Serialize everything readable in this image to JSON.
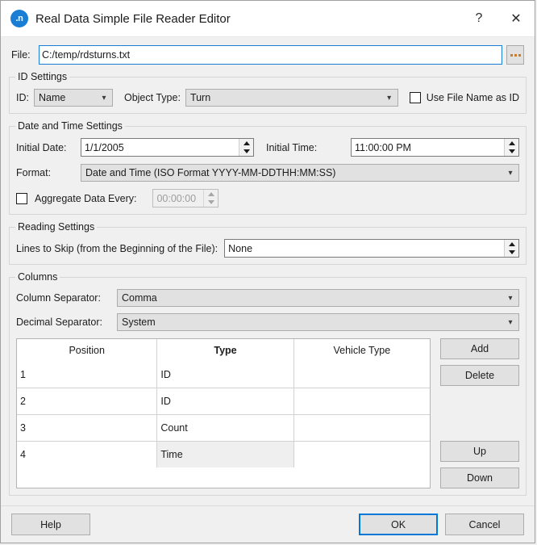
{
  "window": {
    "title": "Real Data Simple File Reader Editor",
    "icon_label": ".n",
    "help_icon": "?",
    "close_icon": "✕"
  },
  "file": {
    "label": "File:",
    "value": "C:/temp/rdsturns.txt",
    "browse_label": "..."
  },
  "id_settings": {
    "title": "ID Settings",
    "id_label": "ID:",
    "id_value": "Name",
    "object_type_label": "Object Type:",
    "object_type_value": "Turn",
    "use_file_name_label": "Use File Name as ID",
    "use_file_name_checked": false
  },
  "date_time_settings": {
    "title": "Date and Time Settings",
    "initial_date_label": "Initial Date:",
    "initial_date_value": "1/1/2005",
    "initial_time_label": "Initial Time:",
    "initial_time_value": "11:00:00 PM",
    "format_label": "Format:",
    "format_value": "Date and Time (ISO Format YYYY-MM-DDTHH:MM:SS)",
    "aggregate_label": "Aggregate Data Every:",
    "aggregate_value": "00:00:00",
    "aggregate_checked": false,
    "aggregate_enabled": false
  },
  "reading_settings": {
    "title": "Reading Settings",
    "lines_to_skip_label": "Lines to Skip (from the Beginning of the File):",
    "lines_to_skip_value": "None"
  },
  "columns": {
    "title": "Columns",
    "column_separator_label": "Column Separator:",
    "column_separator_value": "Comma",
    "decimal_separator_label": "Decimal Separator:",
    "decimal_separator_value": "System",
    "headers": [
      "Position",
      "Type",
      "Vehicle Type"
    ],
    "rows": [
      {
        "position": "1",
        "type": "ID",
        "vehicle_type": ""
      },
      {
        "position": "2",
        "type": "ID",
        "vehicle_type": ""
      },
      {
        "position": "3",
        "type": "Count",
        "vehicle_type": ""
      },
      {
        "position": "4",
        "type": "Time",
        "vehicle_type": "",
        "selected": true
      }
    ],
    "add_label": "Add",
    "delete_label": "Delete",
    "up_label": "Up",
    "down_label": "Down"
  },
  "footer": {
    "help_label": "Help",
    "ok_label": "OK",
    "cancel_label": "Cancel"
  },
  "colors": {
    "accent": "#0078d7",
    "focus_border": "#1a7fd4",
    "dialog_bg": "#f0f0f0",
    "control_bg": "#e1e1e1",
    "selection_bg": "#efefef",
    "browse_dots": "#c87d28"
  }
}
